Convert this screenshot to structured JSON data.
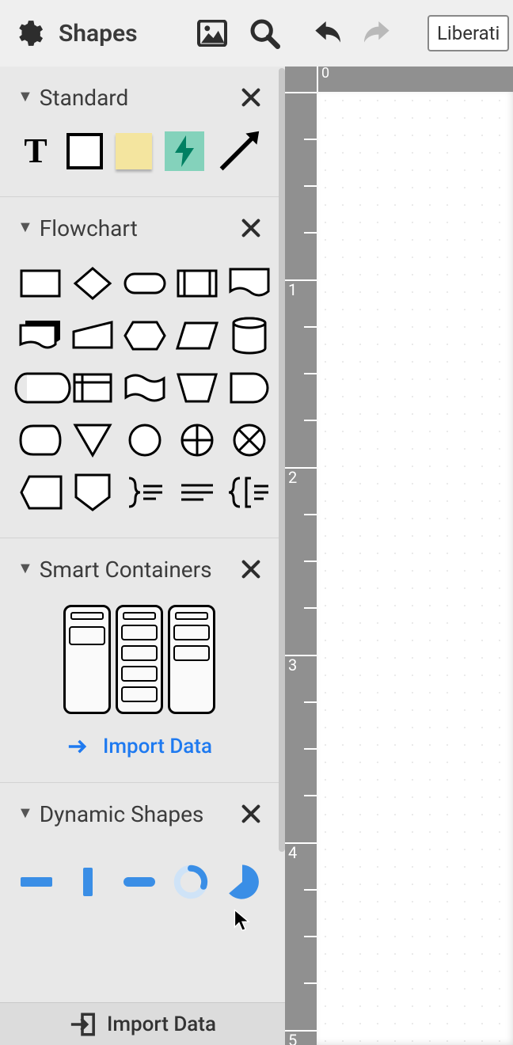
{
  "topbar": {
    "shapes_label": "Shapes",
    "font_box_text": "Liberati"
  },
  "sections": {
    "standard": {
      "title": "Standard",
      "items": [
        "text",
        "rectangle",
        "sticky-note",
        "energy",
        "arrow"
      ]
    },
    "flowchart": {
      "title": "Flowchart",
      "items": [
        "process",
        "decision",
        "terminator",
        "predefined-process",
        "document",
        "multi-document",
        "manual-input",
        "preparation",
        "parallelogram",
        "database",
        "stored-data",
        "internal-storage",
        "paper-tape",
        "manual-operation",
        "delay",
        "display",
        "merge",
        "connector",
        "summing-junction",
        "or-junction",
        "offpage",
        "offpage-down",
        "brace-right",
        "equals",
        "brace-left-group"
      ]
    },
    "smart_containers": {
      "title": "Smart Containers",
      "import_label": "Import Data"
    },
    "dynamic_shapes": {
      "title": "Dynamic Shapes",
      "items": [
        "progress-bar-horizontal",
        "progress-bar-vertical",
        "progress-pill",
        "progress-ring",
        "pie-slice"
      ]
    }
  },
  "ruler": {
    "h_labels": [
      "0"
    ],
    "v_labels": [
      "1",
      "2",
      "3",
      "4",
      "5"
    ]
  },
  "bottom_import_label": "Import Data"
}
